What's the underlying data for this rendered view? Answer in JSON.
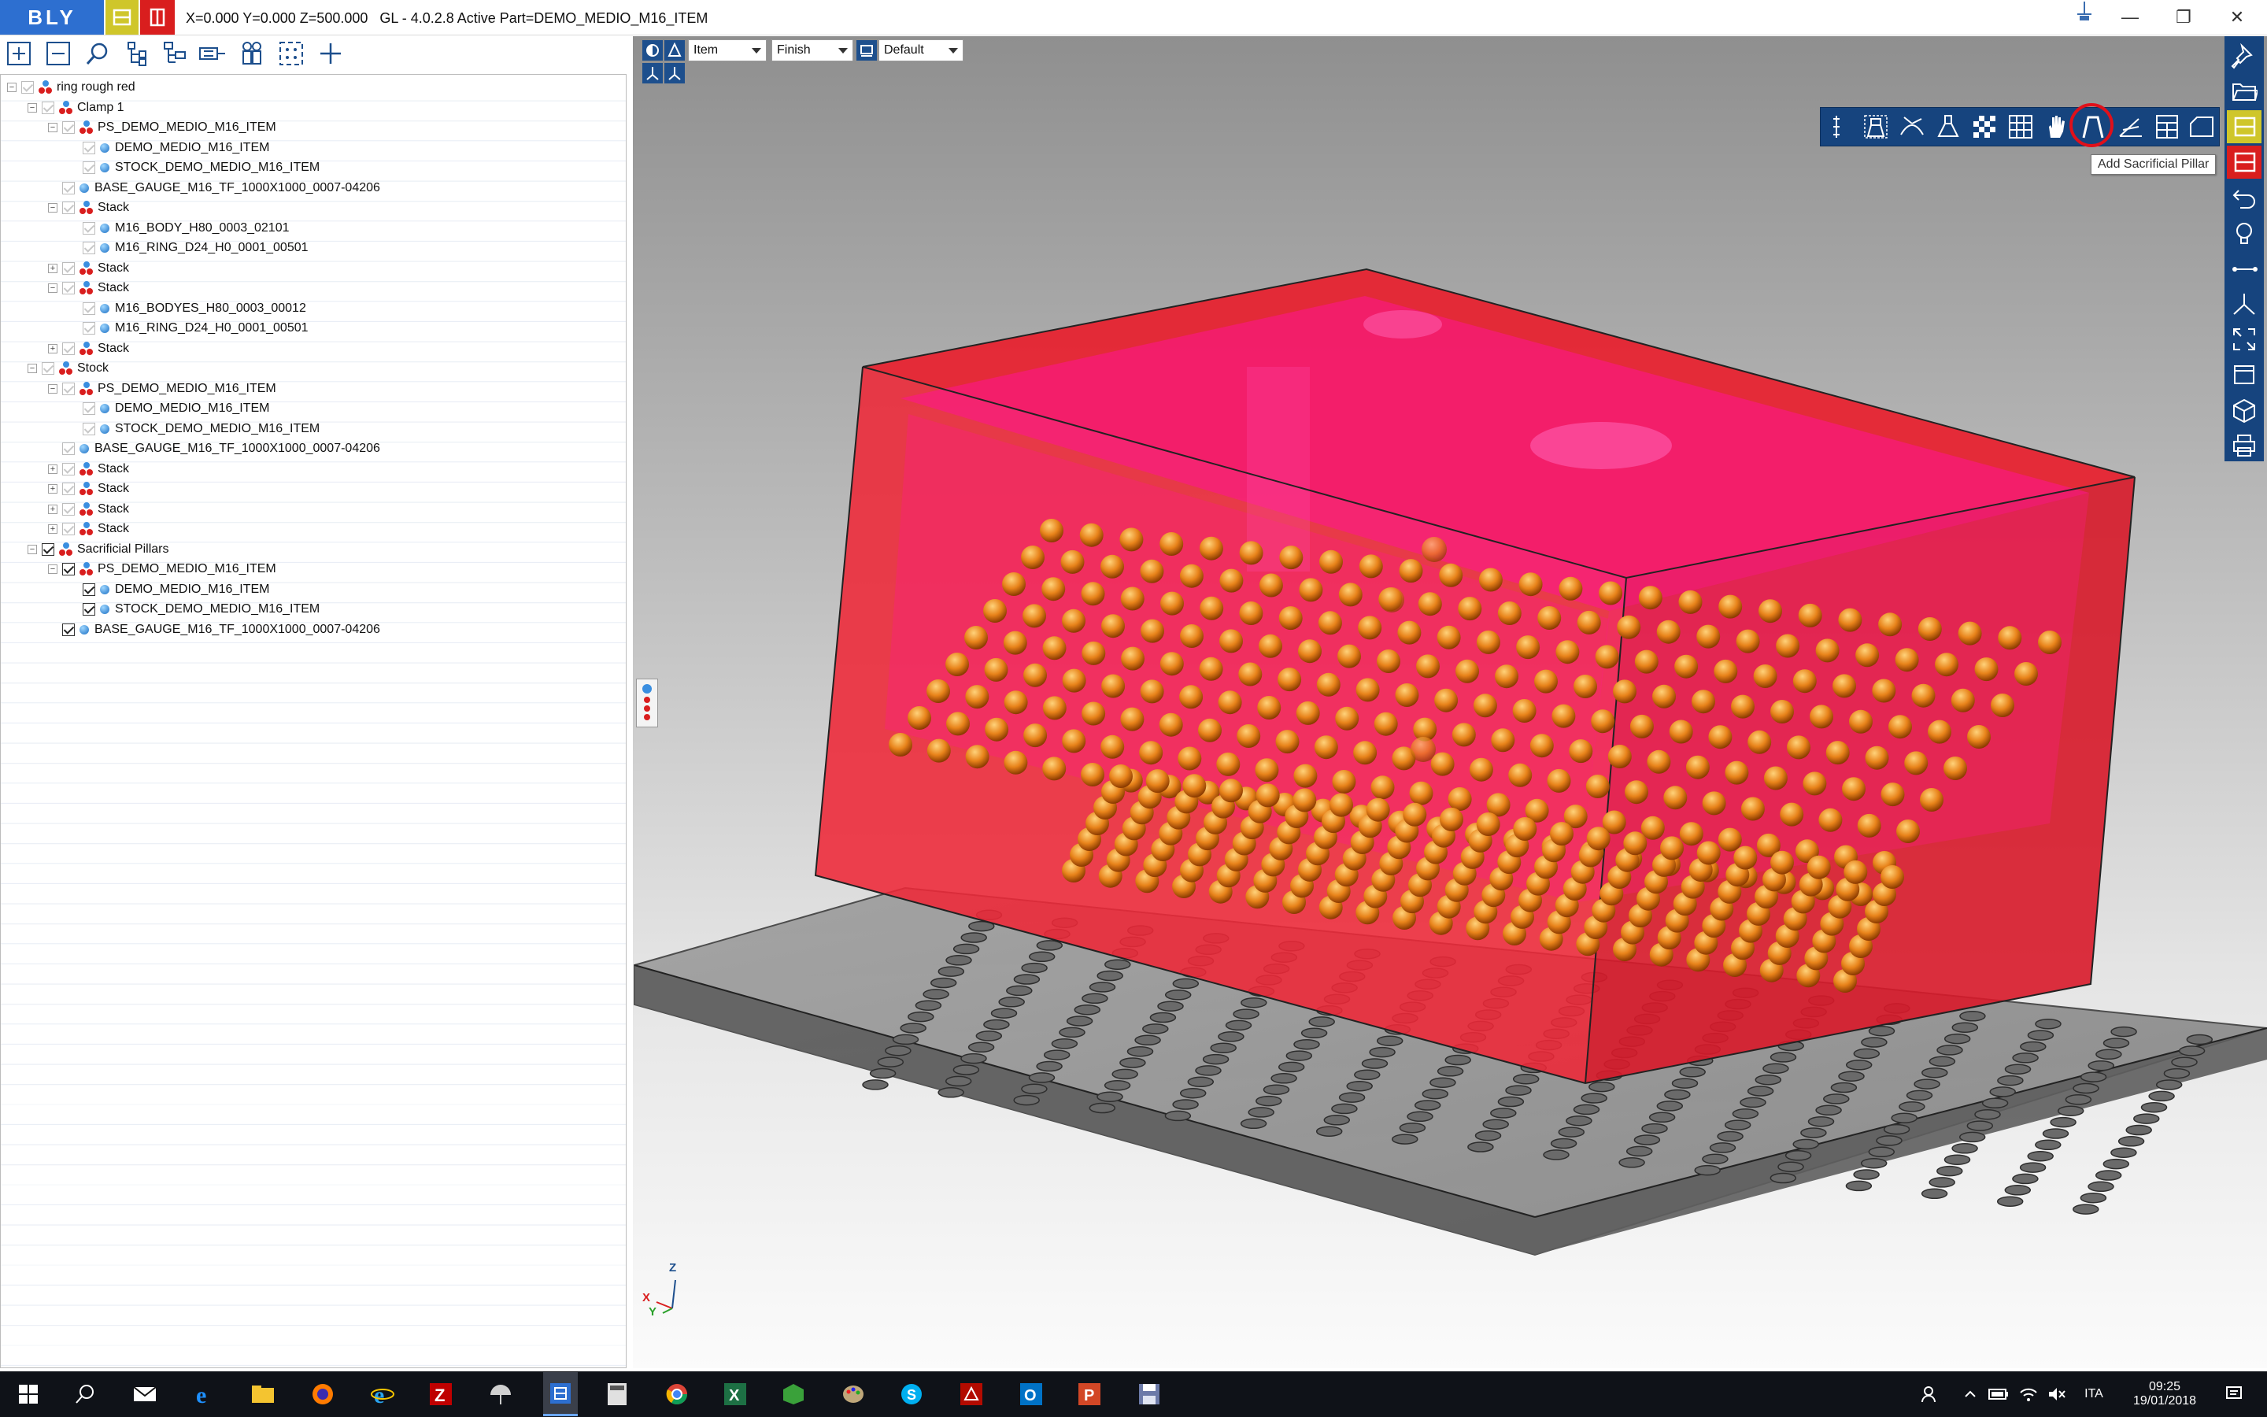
{
  "window": {
    "logo_text": "BLY",
    "title": "X=0.000 Y=0.000 Z=500.000   GL - 4.0.2.8 Active Part=DEMO_MEDIO_M16_ITEM"
  },
  "tree": [
    {
      "label": "ring rough red",
      "depth": 0,
      "kind": "group",
      "checked": false,
      "expander": "minus"
    },
    {
      "label": "Clamp 1",
      "depth": 1,
      "kind": "group",
      "checked": false,
      "expander": "minus"
    },
    {
      "label": "PS_DEMO_MEDIO_M16_ITEM",
      "depth": 2,
      "kind": "group",
      "checked": false,
      "expander": "minus"
    },
    {
      "label": "DEMO_MEDIO_M16_ITEM",
      "depth": 3,
      "kind": "part",
      "checked": false,
      "expander": ""
    },
    {
      "label": "STOCK_DEMO_MEDIO_M16_ITEM",
      "depth": 3,
      "kind": "part",
      "checked": false,
      "expander": ""
    },
    {
      "label": "BASE_GAUGE_M16_TF_1000X1000_0007-04206",
      "depth": 2,
      "kind": "part",
      "checked": false,
      "expander": ""
    },
    {
      "label": "Stack",
      "depth": 2,
      "kind": "group",
      "checked": false,
      "expander": "minus"
    },
    {
      "label": "M16_BODY_H80_0003_02101",
      "depth": 3,
      "kind": "part",
      "checked": false,
      "expander": ""
    },
    {
      "label": "M16_RING_D24_H0_0001_00501",
      "depth": 3,
      "kind": "part",
      "checked": false,
      "expander": ""
    },
    {
      "label": "Stack",
      "depth": 2,
      "kind": "group",
      "checked": false,
      "expander": "plus"
    },
    {
      "label": "Stack",
      "depth": 2,
      "kind": "group",
      "checked": false,
      "expander": "minus"
    },
    {
      "label": "M16_BODYES_H80_0003_00012",
      "depth": 3,
      "kind": "part",
      "checked": false,
      "expander": ""
    },
    {
      "label": "M16_RING_D24_H0_0001_00501",
      "depth": 3,
      "kind": "part",
      "checked": false,
      "expander": ""
    },
    {
      "label": "Stack",
      "depth": 2,
      "kind": "group",
      "checked": false,
      "expander": "plus"
    },
    {
      "label": "Stock",
      "depth": 1,
      "kind": "group",
      "checked": false,
      "expander": "minus"
    },
    {
      "label": "PS_DEMO_MEDIO_M16_ITEM",
      "depth": 2,
      "kind": "group",
      "checked": false,
      "expander": "minus"
    },
    {
      "label": "DEMO_MEDIO_M16_ITEM",
      "depth": 3,
      "kind": "part",
      "checked": false,
      "expander": ""
    },
    {
      "label": "STOCK_DEMO_MEDIO_M16_ITEM",
      "depth": 3,
      "kind": "part",
      "checked": false,
      "expander": ""
    },
    {
      "label": "BASE_GAUGE_M16_TF_1000X1000_0007-04206",
      "depth": 2,
      "kind": "part",
      "checked": false,
      "expander": ""
    },
    {
      "label": "Stack",
      "depth": 2,
      "kind": "group",
      "checked": false,
      "expander": "plus"
    },
    {
      "label": "Stack",
      "depth": 2,
      "kind": "group",
      "checked": false,
      "expander": "plus"
    },
    {
      "label": "Stack",
      "depth": 2,
      "kind": "group",
      "checked": false,
      "expander": "plus"
    },
    {
      "label": "Stack",
      "depth": 2,
      "kind": "group",
      "checked": false,
      "expander": "plus"
    },
    {
      "label": "Sacrificial Pillars",
      "depth": 1,
      "kind": "group",
      "checked": true,
      "expander": "minus"
    },
    {
      "label": "PS_DEMO_MEDIO_M16_ITEM",
      "depth": 2,
      "kind": "group",
      "checked": true,
      "expander": "minus"
    },
    {
      "label": "DEMO_MEDIO_M16_ITEM",
      "depth": 3,
      "kind": "part",
      "checked": true,
      "expander": ""
    },
    {
      "label": "STOCK_DEMO_MEDIO_M16_ITEM",
      "depth": 3,
      "kind": "part",
      "checked": true,
      "expander": ""
    },
    {
      "label": "BASE_GAUGE_M16_TF_1000X1000_0007-04206",
      "depth": 2,
      "kind": "part",
      "checked": true,
      "expander": ""
    }
  ],
  "view": {
    "mode_select": "Item",
    "quality_select": "Finish",
    "preset_select": "Default"
  },
  "tooltip": "Add Sacrificial Pillar",
  "axes": {
    "z": "Z",
    "x": "X",
    "y": "Y"
  },
  "taskbar": {
    "language": "ITA",
    "time": "09:25",
    "date": "19/01/2018"
  },
  "colors": {
    "accent_blue": "#16447e",
    "logo_blue": "#2d6fd0",
    "stock_red": "#e8202e",
    "part_magenta": "#ff1493",
    "pillar_orange": "#e8831a"
  }
}
